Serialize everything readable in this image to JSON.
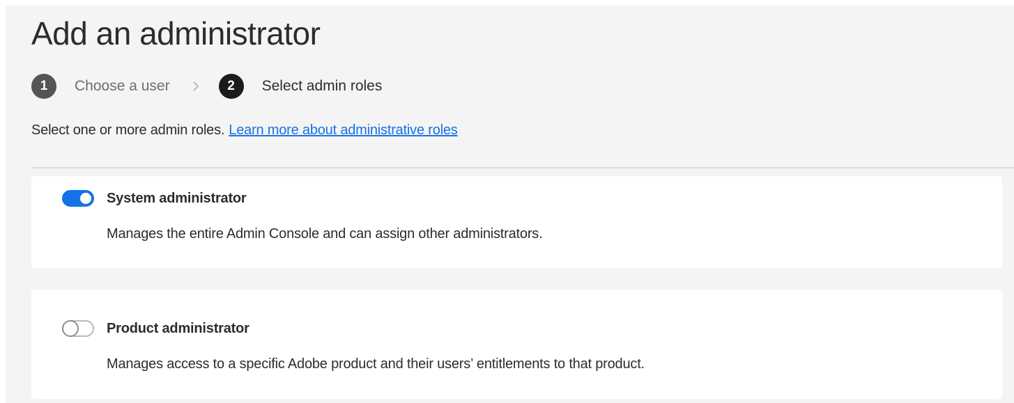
{
  "page": {
    "title": "Add an administrator"
  },
  "stepper": {
    "steps": [
      {
        "number": "1",
        "label": "Choose a user",
        "state": "completed"
      },
      {
        "number": "2",
        "label": "Select admin roles",
        "state": "active"
      }
    ],
    "separator_icon": "chevron-right-icon"
  },
  "intro": {
    "text": "Select one or more admin roles.",
    "link_label": "Learn more about administrative roles"
  },
  "roles": [
    {
      "name": "System administrator",
      "description": "Manages the entire Admin Console and can assign other administrators.",
      "enabled": true
    },
    {
      "name": "Product administrator",
      "description": "Manages access to a specific Adobe product and their users’ entitlements to that product.",
      "enabled": false
    }
  ],
  "colors": {
    "accent": "#1473e6",
    "background": "#f4f4f4",
    "card": "#ffffff",
    "text": "#2c2c2c"
  }
}
